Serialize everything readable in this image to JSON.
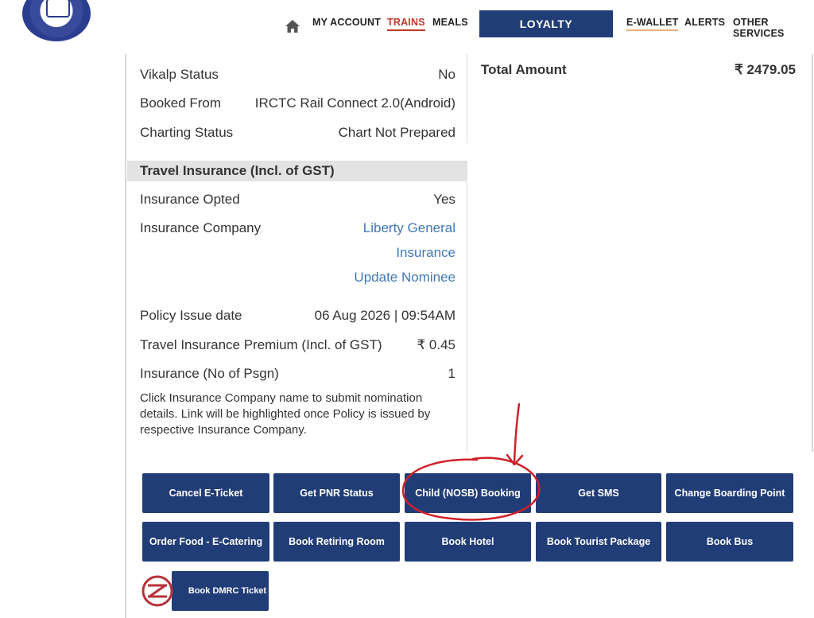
{
  "header": {
    "nav_items": [
      "MY ACCOUNT",
      "TRAINS",
      "MEALS",
      "E-WALLET",
      "ALERTS",
      "OTHER SERVICES"
    ],
    "loyalty_label": "LOYALTY",
    "icons": {
      "home": "home-icon",
      "logo": "irctc-logo"
    }
  },
  "booking": {
    "rows": [
      {
        "label": "Vikalp Status",
        "value": "No"
      },
      {
        "label": "Booked From",
        "value": "IRCTC Rail Connect 2.0(Android)"
      },
      {
        "label": "Charting Status",
        "value": "Chart Not Prepared"
      }
    ],
    "total_label": "Total Amount",
    "total_value": "₹ 2479.05"
  },
  "insurance": {
    "heading": "Travel Insurance (Incl. of GST)",
    "opted_label": "Insurance Opted",
    "opted_value": "Yes",
    "company_label": "Insurance Company",
    "company_line1": "Liberty General",
    "company_line2": "Insurance",
    "update_nominee": "Update Nominee",
    "issue_label": "Policy Issue date",
    "issue_value": "06 Aug 2026 | 09:54AM",
    "premium_label": "Travel Insurance Premium (Incl. of GST)",
    "premium_value": "₹ 0.45",
    "psgn_label": "Insurance (No of Psgn)",
    "psgn_value": "1",
    "note": "Click Insurance Company name to submit nomination details. Link will be highlighted once Policy is issued by respective Insurance Company."
  },
  "actions": {
    "row1": [
      "Cancel E-Ticket",
      "Get PNR Status",
      "Child (NOSB) Booking",
      "Get SMS",
      "Change Boarding Point"
    ],
    "row2": [
      "Order Food - E-Catering",
      "Book Retiring Room",
      "Book Hotel",
      "Book Tourist Package",
      "Book Bus"
    ],
    "dmrc": "Book DMRC Ticket"
  },
  "colors": {
    "primary": "#213d77",
    "link": "#3f78b7",
    "annotation": "#d0202a",
    "active_nav": "#c0392b"
  }
}
